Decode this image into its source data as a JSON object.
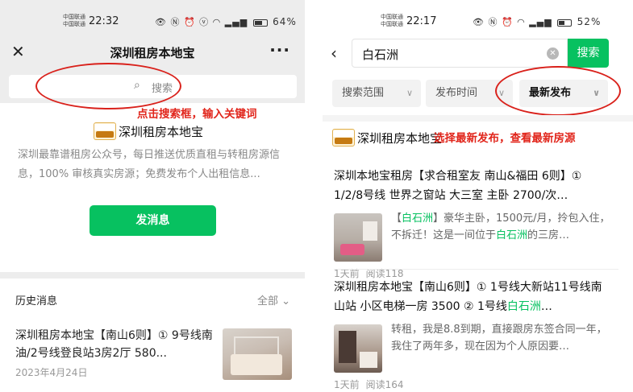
{
  "left": {
    "status": {
      "carrier1": "中国联通",
      "carrier2": "中国联通",
      "time": "22:32",
      "battery_pct": "64%",
      "battery_level": 0.64
    },
    "title": "深圳租房本地宝",
    "search_placeholder": "搜索",
    "profile": {
      "logo_top": "本地宝",
      "logo_bottom": "深圳租房宝",
      "name": "深圳租房本地宝",
      "description": "深圳最靠谱租房公众号，每日推送优质直租与转租房源信息，100% 审核真实房源；免费发布个人出租信息..."
    },
    "send_button": "发消息",
    "history": {
      "title": "历史消息",
      "filter": "全部",
      "item": {
        "title": "深圳租房本地宝【南山6则】① 9号线南油/2号线登良站3房2厅 580...",
        "date": "2023年4月24日"
      }
    },
    "annotation": "点击搜索框，输入关键词"
  },
  "right": {
    "status": {
      "carrier1": "中国联通",
      "carrier2": "中国联通",
      "time": "22:17",
      "battery_pct": "52%",
      "battery_level": 0.52
    },
    "search_value": "白石洲",
    "search_button": "搜索",
    "filters": [
      "搜索范围",
      "发布时间",
      "最新发布"
    ],
    "profile_name": "深圳租房本地宝",
    "annotation": "选择最新发布，查看最新房源",
    "results": [
      {
        "title": "深圳本地宝租房【求合租室友 南山&福田 6则】① 1/2/8号线 世界之窗站 大三室 主卧 2700/次…",
        "text_parts": [
          "【",
          "白石洲",
          "】豪华主卧，1500元/月，拎包入住，不拆迁！这是一间位于",
          "白石洲",
          "的三房…"
        ],
        "time": "1天前",
        "reads": "阅读118"
      },
      {
        "title_parts": [
          "深圳租房本地宝【南山6则】① 1号线大新站11号线南山站 小区电梯一房 3500 ② 1号线",
          "白石洲",
          "…"
        ],
        "text": "转租，我是8.8到期，直接跟房东签合同一年，我住了两年多，现在因为个人原因要…",
        "time": "1天前",
        "reads": "阅读164"
      }
    ]
  },
  "colors": {
    "accent_green": "#07c160",
    "annotation_red": "#e1251b"
  },
  "icons": {
    "close": "close-icon",
    "more": "more-icon",
    "search": "search-icon",
    "back": "back-arrow-icon",
    "clear": "clear-icon",
    "chevron": "chevron-down-icon"
  }
}
